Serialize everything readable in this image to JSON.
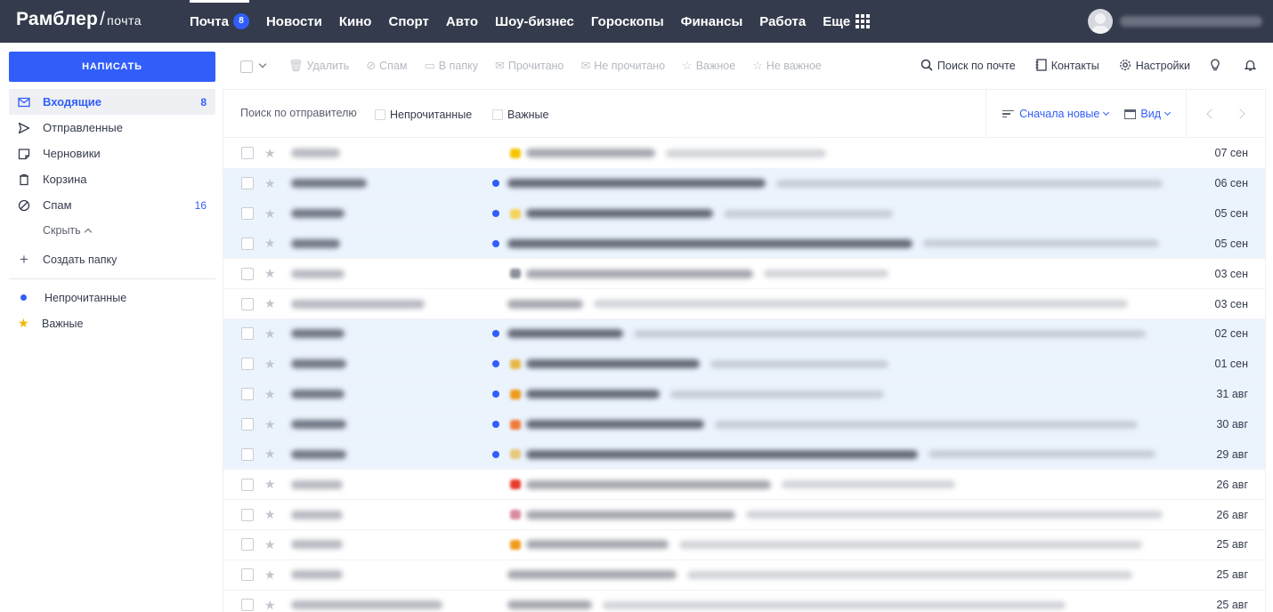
{
  "header": {
    "logo_main": "Рамблер",
    "logo_slash": "/",
    "logo_sub": "почта",
    "nav": [
      {
        "label": "Почта",
        "badge": "8"
      },
      {
        "label": "Новости"
      },
      {
        "label": "Кино"
      },
      {
        "label": "Спорт"
      },
      {
        "label": "Авто"
      },
      {
        "label": "Шоу-бизнес"
      },
      {
        "label": "Гороскопы"
      },
      {
        "label": "Финансы"
      },
      {
        "label": "Работа"
      },
      {
        "label": "Еще"
      }
    ]
  },
  "sidebar": {
    "compose": "НАПИСАТЬ",
    "folders": [
      {
        "label": "Входящие",
        "count": "8",
        "icon": "inbox-icon"
      },
      {
        "label": "Отправленные",
        "count": "",
        "icon": "sent-icon"
      },
      {
        "label": "Черновики",
        "count": "",
        "icon": "drafts-icon"
      },
      {
        "label": "Корзина",
        "count": "",
        "icon": "trash-icon"
      },
      {
        "label": "Спам",
        "count": "16",
        "icon": "spam-icon"
      }
    ],
    "hide": "Скрыть",
    "create_folder": "Создать папку",
    "filters": [
      {
        "label": "Непрочитанные"
      },
      {
        "label": "Важные"
      }
    ]
  },
  "toolbar": {
    "actions": [
      {
        "label": "Удалить",
        "icon": "trash-icon",
        "glyph": "🗑"
      },
      {
        "label": "Спам",
        "icon": "spam-icon",
        "glyph": "⊘"
      },
      {
        "label": "В папку",
        "icon": "folder-icon",
        "glyph": "▭"
      },
      {
        "label": "Прочитано",
        "icon": "envelope-open-icon",
        "glyph": "✉"
      },
      {
        "label": "Не прочитано",
        "icon": "envelope-icon",
        "glyph": "✉"
      },
      {
        "label": "Важное",
        "icon": "star-icon",
        "glyph": "☆"
      },
      {
        "label": "Не важное",
        "icon": "star-off-icon",
        "glyph": "☆"
      }
    ],
    "search": "Поиск по почте",
    "contacts": "Контакты",
    "settings": "Настройки"
  },
  "filterbar": {
    "search_sender": "Поиск по отправителю",
    "unread": "Непрочитанные",
    "important": "Важные",
    "sort": "Сначала новые",
    "view": "Вид"
  },
  "mails": [
    {
      "date": "07 сен",
      "unread": false,
      "emoji": "#f5c400"
    },
    {
      "date": "06 сен",
      "unread": true,
      "emoji": ""
    },
    {
      "date": "05 сен",
      "unread": true,
      "emoji": "#f5d25a"
    },
    {
      "date": "05 сен",
      "unread": true,
      "emoji": ""
    },
    {
      "date": "03 сен",
      "unread": false,
      "emoji": "#8a8f99"
    },
    {
      "date": "03 сен",
      "unread": false,
      "emoji": ""
    },
    {
      "date": "02 сен",
      "unread": true,
      "emoji": ""
    },
    {
      "date": "01 сен",
      "unread": true,
      "emoji": "#e6b84a"
    },
    {
      "date": "31 авг",
      "unread": true,
      "emoji": "#f09a1a"
    },
    {
      "date": "30 авг",
      "unread": true,
      "emoji": "#f07a3a"
    },
    {
      "date": "29 авг",
      "unread": true,
      "emoji": "#e8c87a"
    },
    {
      "date": "26 авг",
      "unread": false,
      "emoji": "#e83a2a"
    },
    {
      "date": "26 авг",
      "unread": false,
      "emoji": "#d88aa0"
    },
    {
      "date": "25 авг",
      "unread": false,
      "emoji": "#f09a1a"
    },
    {
      "date": "25 авг",
      "unread": false,
      "emoji": ""
    },
    {
      "date": "25 авг",
      "unread": false,
      "emoji": ""
    }
  ]
}
